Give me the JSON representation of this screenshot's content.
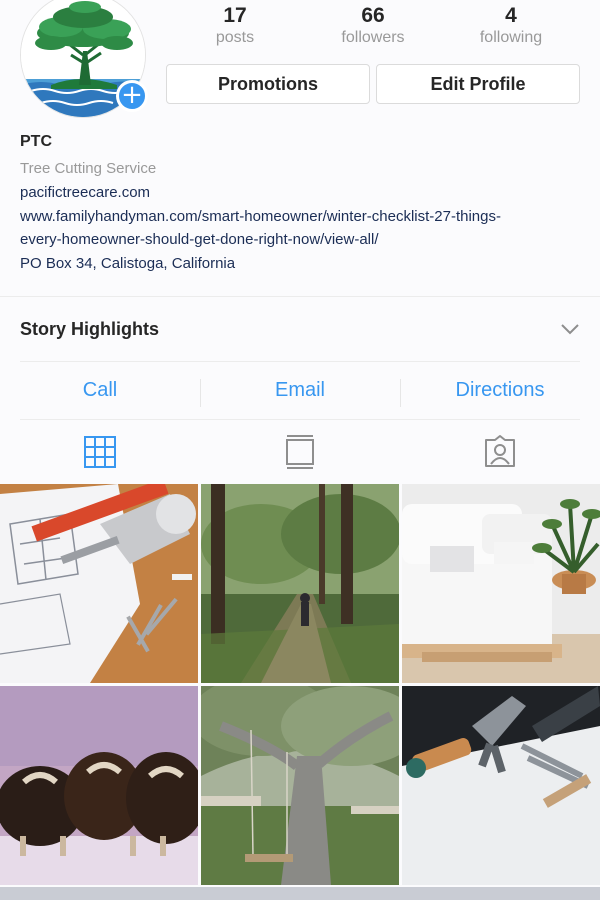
{
  "profile": {
    "stats": [
      {
        "value": "17",
        "label": "posts"
      },
      {
        "value": "66",
        "label": "followers"
      },
      {
        "value": "4",
        "label": "following"
      }
    ],
    "buttons": {
      "promotions": "Promotions",
      "edit_profile": "Edit Profile"
    },
    "add_icon": "plus-icon"
  },
  "bio": {
    "name": "PTC",
    "category": "Tree Cutting Service",
    "website": "pacifictreecare.com",
    "link_line1": "www.familyhandyman.com/smart-homeowner/winter-checklist-27-things-",
    "link_line2": "every-homeowner-should-get-done-right-now/view-all/",
    "address": "PO Box 34, Calistoga, California"
  },
  "highlights": {
    "label": "Story Highlights",
    "icon": "chevron-down-icon"
  },
  "contacts": {
    "call": "Call",
    "email": "Email",
    "directions": "Directions"
  },
  "tabs": [
    {
      "icon": "grid-icon",
      "active": true
    },
    {
      "icon": "feed-icon",
      "active": false
    },
    {
      "icon": "tagged-icon",
      "active": false
    }
  ],
  "colors": {
    "accent": "#3897f0",
    "text": "#262626",
    "muted": "#999999",
    "link": "#1b2d55"
  },
  "grid_posts": [
    "blueprints-drill",
    "forest-path-walker",
    "white-sofa-room",
    "musk-oxen",
    "tree-swing",
    "tools-on-paper"
  ]
}
